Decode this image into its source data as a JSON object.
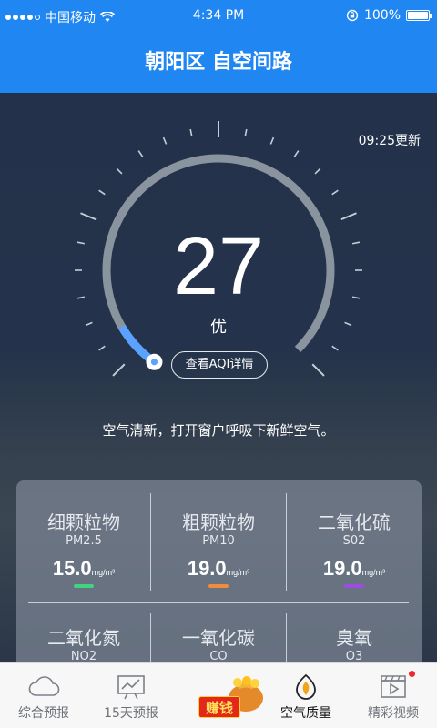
{
  "status_bar": {
    "carrier": "中国移动",
    "time": "4:34 PM",
    "battery": "100%"
  },
  "header": {
    "title": "朝阳区 自空间路"
  },
  "aqi": {
    "update_time": "09:25更新",
    "value": "27",
    "level": "优",
    "detail_button": "查看AQI详情",
    "gauge_fraction": 0.054,
    "advice": "空气清新，打开窗户呼吸下新鲜空气。",
    "colors": {
      "arc_track": "#8a949f",
      "arc_progress": "#5aa2ff"
    }
  },
  "pollutants": [
    {
      "name": "细颗粒物",
      "code": "PM2.5",
      "value": "15.0",
      "unit": "mg/m³",
      "color": "#3fd47d"
    },
    {
      "name": "粗颗粒物",
      "code": "PM10",
      "value": "19.0",
      "unit": "mg/m³",
      "color": "#f08c3c"
    },
    {
      "name": "二氧化硫",
      "code": "S02",
      "value": "19.0",
      "unit": "mg/m³",
      "color": "#9b4de0"
    },
    {
      "name": "二氧化氮",
      "code": "NO2"
    },
    {
      "name": "一氧化碳",
      "code": "CO"
    },
    {
      "name": "臭氧",
      "code": "O3"
    }
  ],
  "nav": {
    "items": [
      {
        "label": "综合预报",
        "icon": "cloud-icon"
      },
      {
        "label": "15天预报",
        "icon": "chart-board-icon"
      },
      {
        "label": "赚钱",
        "icon": "money-bag-icon"
      },
      {
        "label": "空气质量",
        "icon": "leaf-drop-icon"
      },
      {
        "label": "精彩视频",
        "icon": "video-clapper-icon"
      }
    ],
    "active": "空气质量"
  }
}
